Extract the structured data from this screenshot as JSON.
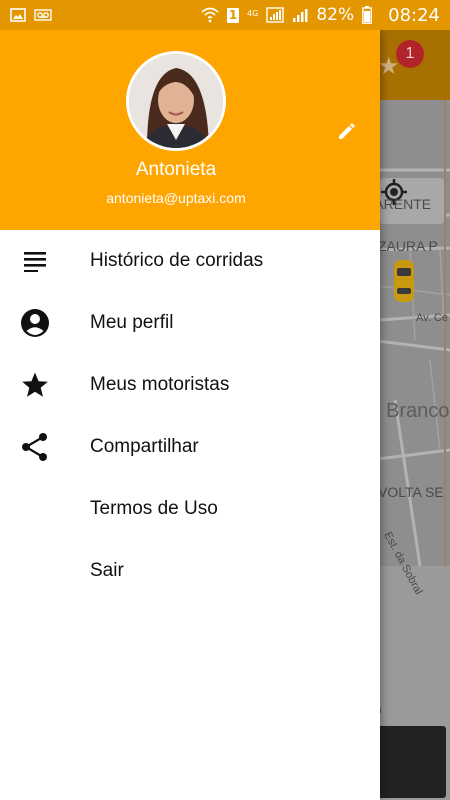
{
  "status_bar": {
    "sim_badge": "1",
    "network": "4G",
    "battery": "82%",
    "time": "08:24",
    "color": "#E39600"
  },
  "map": {
    "badge_count": "1",
    "labels": [
      "PARENTE",
      "IZAURA P",
      "Av. Ce",
      "Branco",
      "VOLTA SE",
      "Est. da Sobral"
    ],
    "bottom_text": "in"
  },
  "drawer": {
    "header_color": "#FFA500",
    "profile": {
      "name": "Antonieta",
      "email": "antonieta@uptaxi.com"
    },
    "menu": [
      {
        "label": "Histórico de corridas",
        "icon": "history-list-icon"
      },
      {
        "label": "Meu perfil",
        "icon": "account-circle-icon"
      },
      {
        "label": "Meus motoristas",
        "icon": "star-icon"
      },
      {
        "label": "Compartilhar",
        "icon": "share-icon"
      },
      {
        "label": "Termos de Uso",
        "icon": ""
      },
      {
        "label": "Sair",
        "icon": ""
      }
    ]
  }
}
